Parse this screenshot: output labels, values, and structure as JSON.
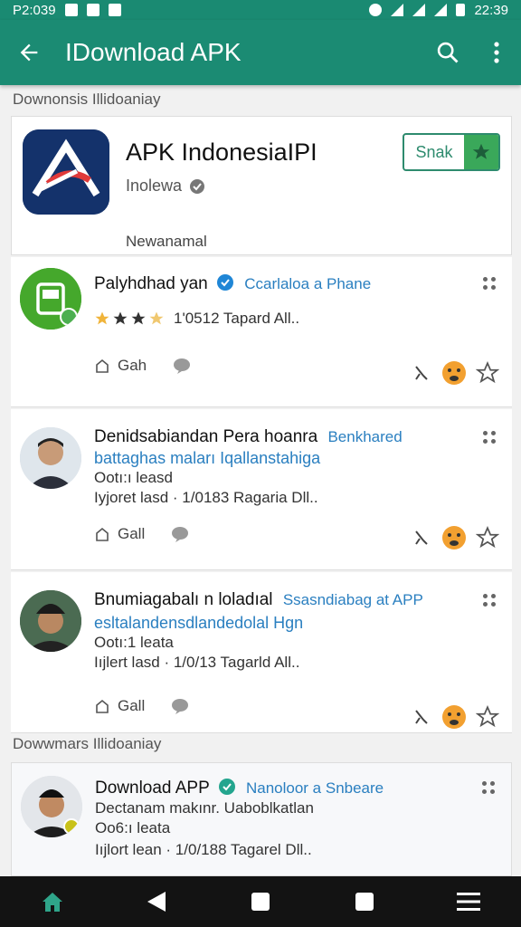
{
  "status": {
    "time_left": "P2:039",
    "time_right": "22:39"
  },
  "appbar": {
    "title": "IDownload APK"
  },
  "sections": [
    {
      "label": "Downonsis Illidoaniay"
    },
    {
      "label": "Dowwmars Illidoaniay"
    }
  ],
  "hero": {
    "name": "APK IndonesiaIPI",
    "developer": "Inolewa",
    "subtitle": "Newanamal",
    "snak_label": "Snak"
  },
  "posts": [
    {
      "author": "Palyhdhad yan",
      "link": "Ccarlaloa a Phane",
      "rating": 3.5,
      "meta": "1'0512 Tapard All..",
      "action_label": "Gah"
    },
    {
      "author": "Denidsabiandan Pera hoanra",
      "link": "Benkhared",
      "line1": "battaghas maları Iqallanstahiga",
      "line2": "Ootı:ı leasd",
      "meta": "Iyjoret lasd · 1/0183 Ragaria Dll..",
      "action_label": "Gall"
    },
    {
      "author": "Bnumiagabalı n loladıal",
      "link": "Ssasndiabag at APP",
      "line1": "esltalandensdlandedolal Hgn",
      "line2": "Ootı:1 leata",
      "meta": "Iıjlert lasd · 1/0/13 Tagarld All..",
      "action_label": "Gall"
    },
    {
      "author": "Download APP",
      "link": "Nanoloor a Snbeare",
      "line1": "Dectanam makınr. Uaboblkatlan",
      "line2": "Oo6:ı leata",
      "meta": "Iıjlort lean · 1/0/188 Tagarel Dll.."
    }
  ],
  "colors": {
    "accent": "#1b8b73",
    "link": "#2a7fc0",
    "star": "#f0b43a"
  }
}
